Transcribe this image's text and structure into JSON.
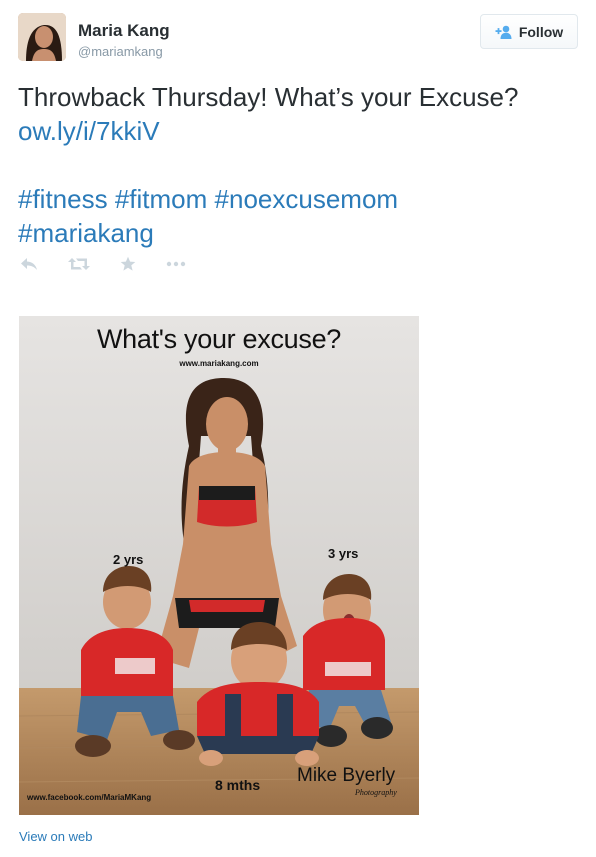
{
  "author": {
    "name": "Maria Kang",
    "handle": "@mariamkang"
  },
  "follow_button": {
    "label": "Follow",
    "icon": "add-person-icon"
  },
  "tweet": {
    "text": "Throwback Thursday! What’s your Excuse?",
    "link": "ow.ly/i/7kkiV",
    "hashtags": [
      "#fitness",
      "#fitmom",
      "#noexcusemom",
      "#mariakang"
    ]
  },
  "actions": [
    {
      "name": "reply",
      "icon": "reply-icon"
    },
    {
      "name": "retweet",
      "icon": "retweet-icon"
    },
    {
      "name": "favorite",
      "icon": "star-icon"
    },
    {
      "name": "more",
      "icon": "more-dots-icon"
    }
  ],
  "photo": {
    "title": "What's your excuse?",
    "website": "www.mariakang.com",
    "label_left": "2 yrs",
    "label_right": "3 yrs",
    "label_bottom": "8 mths",
    "facebook": "www.facebook.com/MariaMKang",
    "credit": "Mike Byerly",
    "credit_sub": "Photography"
  },
  "view_on_web": "View on web",
  "colors": {
    "link": "#2b7bb9",
    "text": "#292f33",
    "muted": "#8899a6",
    "icon": "#ccd6dd",
    "follow_icon": "#55acee"
  }
}
